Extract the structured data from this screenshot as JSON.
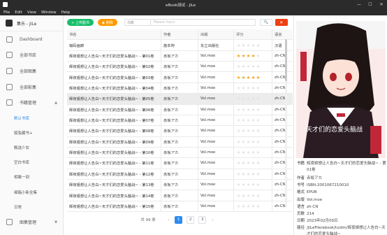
{
  "window": {
    "title": "eBook测试 - JiLe",
    "minimize": "—",
    "maximize": "☐",
    "close": "✕"
  },
  "menu": [
    "File",
    "Edit",
    "View",
    "Window",
    "Help"
  ],
  "sidebar": {
    "app_name": "集乐 - JiLe",
    "items": [
      {
        "label": "Dashboard"
      },
      {
        "label": "全部书库"
      },
      {
        "label": "全部图集"
      },
      {
        "label": "全部影集"
      }
    ],
    "books_group": {
      "label": "书籍管理",
      "chevron": "▲"
    },
    "sub_items": [
      "默认书库",
      "狐兔藏书+",
      "甄选少女",
      "空白书库",
      "相聚一刻",
      "细箱小新全集",
      "日常"
    ],
    "gallery_group": {
      "label": "图集管理",
      "chevron": "▼"
    }
  },
  "toolbar": {
    "add_label": "+ 上传图书",
    "delete_all_label": "◉ 删除",
    "select_value": "书籍",
    "search_placeholder": "Please input",
    "search_btn": "🔍",
    "delete_btn": "✕"
  },
  "table": {
    "headers": {
      "title": "书名",
      "author": "作者",
      "publisher": "出版",
      "rating": "评分",
      "lang": "语言"
    },
    "rows": [
      {
        "title": "输码画廊",
        "author": "施本阿",
        "publisher": "东立出版社",
        "rating": 0,
        "lang": "汉语",
        "sel": false
      },
      {
        "title": "辉夜姬想让人告白~天才们的恋爱头脑战~ - 第01卷",
        "author": "赤坂アカ",
        "publisher": "Vol.moe",
        "rating": 4,
        "lang": "zh-CN",
        "sel": false
      },
      {
        "title": "辉夜姬想让人告白~天才们的恋爱头脑战~ - 第02卷",
        "author": "赤坂アカ",
        "publisher": "Vol.moe",
        "rating": 0,
        "lang": "zh-CN",
        "sel": false
      },
      {
        "title": "辉夜姬想让人告白~天才们的恋爱头脑战~ - 第03卷",
        "author": "赤坂アカ",
        "publisher": "Vol.moe",
        "rating": 5,
        "lang": "zh-CN",
        "sel": false
      },
      {
        "title": "辉夜姬想让人告白~天才们的恋爱头脑战~ - 第04卷",
        "author": "赤坂アカ",
        "publisher": "Vol.moe",
        "rating": 0,
        "lang": "zh-CN",
        "sel": false
      },
      {
        "title": "辉夜姬想让人告白~天才们的恋爱头脑战~ - 第05卷",
        "author": "赤坂アカ",
        "publisher": "Vol.moe",
        "rating": 0,
        "lang": "zh-CN",
        "sel": true
      },
      {
        "title": "辉夜姬想让人告白~天才们的恋爱头脑战~ - 第06卷",
        "author": "赤坂アカ",
        "publisher": "Vol.moe",
        "rating": 0,
        "lang": "zh-CN",
        "sel": false
      },
      {
        "title": "辉夜姬想让人告白~天才们的恋爱头脑战~ - 第07卷",
        "author": "赤坂アカ",
        "publisher": "Vol.moe",
        "rating": 0,
        "lang": "zh-CN",
        "sel": false
      },
      {
        "title": "辉夜姬想让人告白~天才们的恋爱头脑战~ - 第08卷",
        "author": "赤坂アカ",
        "publisher": "Vol.moe",
        "rating": 0,
        "lang": "zh-CN",
        "sel": false
      },
      {
        "title": "辉夜姬想让人告白~天才们的恋爱头脑战~ - 第09卷",
        "author": "赤坂アカ",
        "publisher": "Vol.moe",
        "rating": 0,
        "lang": "zh-CN",
        "sel": false
      },
      {
        "title": "辉夜姬想让人告白~天才们的恋爱头脑战~ - 第10卷",
        "author": "赤坂アカ",
        "publisher": "Vol.moe",
        "rating": 0,
        "lang": "zh-CN",
        "sel": false
      },
      {
        "title": "辉夜姬想让人告白~天才们的恋爱头脑战~ - 第11卷",
        "author": "赤坂アカ",
        "publisher": "Vol.moe",
        "rating": 0,
        "lang": "zh-CN",
        "sel": false
      },
      {
        "title": "辉夜姬想让人告白~天才们的恋爱头脑战~ - 第12卷",
        "author": "赤坂アカ",
        "publisher": "Vol.moe",
        "rating": 0,
        "lang": "zh-CN",
        "sel": false
      },
      {
        "title": "辉夜姬想让人告白~天才们的恋爱头脑战~ - 第13卷",
        "author": "赤坂アカ",
        "publisher": "Vol.moe",
        "rating": 0,
        "lang": "zh-CN",
        "sel": false
      },
      {
        "title": "辉夜姬想让人告白~天才们的恋爱头脑战~ - 第14卷",
        "author": "赤坂アカ",
        "publisher": "Vol.moe",
        "rating": 0,
        "lang": "zh-CN",
        "sel": false
      },
      {
        "title": "辉夜姬想让人告白~天才们的恋爱头脑战~ - 第15卷",
        "author": "赤坂アカ",
        "publisher": "Vol.moe",
        "rating": 0,
        "lang": "zh-CN",
        "sel": false
      }
    ]
  },
  "pagination": {
    "total": "共 99 条",
    "prev": "‹",
    "next": "›",
    "pages": [
      "1",
      "2",
      "3"
    ],
    "active": "1"
  },
  "detail": {
    "cover_text": "天才们的恋爱头脑战",
    "fields": [
      {
        "key": "书籍",
        "value": "辉夜姬想让人告白~天才们的恋爱头脑战~ - 第01卷",
        "tall": true
      },
      {
        "key": "作者",
        "value": "赤坂アカ"
      },
      {
        "key": "书号",
        "value": "ISBN:2001067210010"
      },
      {
        "key": "格式",
        "value": "EPUB"
      },
      {
        "key": "出版",
        "value": "Vol.moe"
      },
      {
        "key": "语言",
        "value": "zh-CN"
      },
      {
        "key": "页数",
        "value": "214"
      },
      {
        "key": "日期",
        "value": "2023年02月09日"
      },
      {
        "key": "路径",
        "value": "/JiLeFile/ebook/ts/dm/辉夜姬想让人告白~天才们的恋爱头脑战~",
        "tall": true
      }
    ]
  },
  "colors": {
    "accent": "#2d8cf0",
    "success": "#19be6b",
    "warning": "#ff9900",
    "danger": "#ed4014",
    "star": "#f5a623"
  }
}
